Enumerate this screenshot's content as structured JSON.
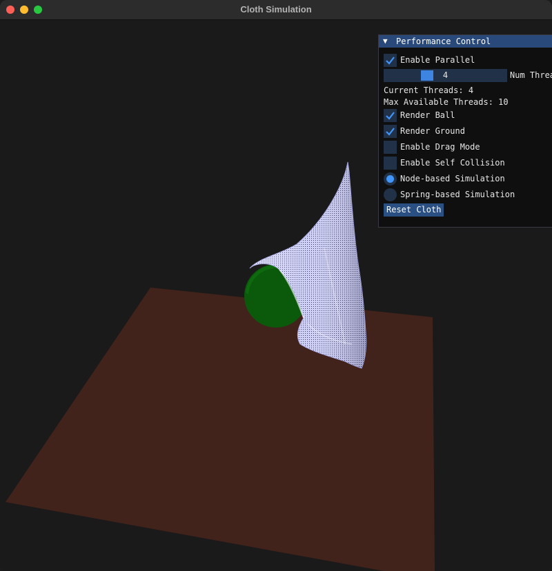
{
  "window": {
    "title": "Cloth Simulation"
  },
  "panel": {
    "title": "Performance Control",
    "enable_parallel": {
      "label": "Enable Parallel",
      "checked": true
    },
    "num_threads": {
      "value": "4",
      "label": "Num Threads"
    },
    "current_threads": "Current Threads: 4",
    "max_threads": "Max Available Threads: 10",
    "render_ball": {
      "label": "Render Ball",
      "checked": true
    },
    "render_ground": {
      "label": "Render Ground",
      "checked": true
    },
    "drag_mode": {
      "label": "Enable Drag Mode",
      "checked": false
    },
    "self_collision": {
      "label": "Enable Self Collision",
      "checked": false
    },
    "node_sim": {
      "label": "Node-based Simulation",
      "selected": true
    },
    "spring_sim": {
      "label": "Spring-based Simulation",
      "selected": false
    },
    "reset_label": "Reset Cloth"
  },
  "colors": {
    "accent": "#4296fa",
    "header": "#29497a",
    "ground": "#42231b",
    "ball": "#0b5a0b",
    "cloth": "#c8c8f5"
  }
}
